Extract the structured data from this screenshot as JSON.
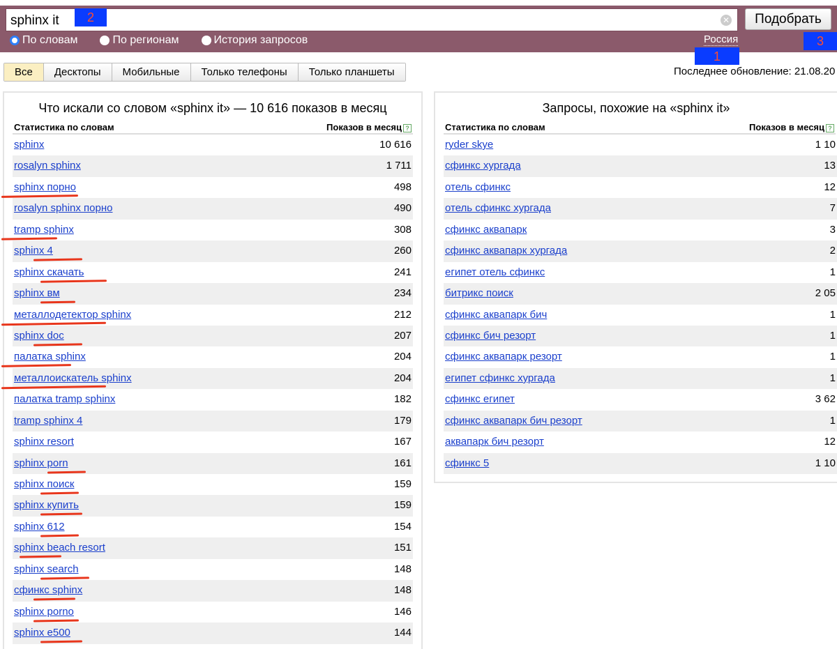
{
  "search": {
    "value": "sphinx it",
    "button": "Подобрать",
    "clear_icon": "clear-icon"
  },
  "modes": [
    {
      "label": "По словам",
      "selected": true
    },
    {
      "label": "По регионам",
      "selected": false
    },
    {
      "label": "История запросов",
      "selected": false
    }
  ],
  "region": "Россия",
  "markers": [
    "1",
    "2",
    "3"
  ],
  "device_tabs": [
    "Все",
    "Десктопы",
    "Мобильные",
    "Только телефоны",
    "Только планшеты"
  ],
  "active_tab": "Все",
  "last_update": "Последнее обновление: 21.08.20",
  "left": {
    "title": "Что искали со словом «sphinx it» — 10 616 показов в месяц",
    "col1": "Статистика по словам",
    "col2": "Показов в месяц",
    "rows": [
      [
        "sphinx",
        "10 616"
      ],
      [
        "rosalyn sphinx",
        "1 711"
      ],
      [
        "sphinx порно",
        "498"
      ],
      [
        "rosalyn sphinx порно",
        "490"
      ],
      [
        "tramp sphinx",
        "308"
      ],
      [
        "sphinx 4",
        "260"
      ],
      [
        "sphinx скачать",
        "241"
      ],
      [
        "sphinx вм",
        "234"
      ],
      [
        "металлодетектор sphinx",
        "212"
      ],
      [
        "sphinx doc",
        "207"
      ],
      [
        "палатка sphinx",
        "204"
      ],
      [
        "металлоискатель sphinx",
        "204"
      ],
      [
        "палатка tramp sphinx",
        "182"
      ],
      [
        "tramp sphinx 4",
        "179"
      ],
      [
        "sphinx resort",
        "167"
      ],
      [
        "sphinx porn",
        "161"
      ],
      [
        "sphinx поиск",
        "159"
      ],
      [
        "sphinx купить",
        "159"
      ],
      [
        "sphinx 612",
        "154"
      ],
      [
        "sphinx beach resort",
        "151"
      ],
      [
        "sphinx search",
        "148"
      ],
      [
        "сфинкс sphinx",
        "148"
      ],
      [
        "sphinx porno",
        "146"
      ],
      [
        "sphinx e500",
        "144"
      ]
    ]
  },
  "right": {
    "title": "Запросы, похожие на «sphinx it»",
    "col1": "Статистика по словам",
    "col2": "Показов в месяц",
    "rows": [
      [
        "ryder skye",
        "1 10"
      ],
      [
        "сфинкс хургада",
        "13"
      ],
      [
        "отель сфинкс",
        "12"
      ],
      [
        "отель сфинкс хургада",
        "7"
      ],
      [
        "сфинкс аквапарк",
        "3"
      ],
      [
        "сфинкс аквапарк хургада",
        "2"
      ],
      [
        "египет отель сфинкс",
        "1"
      ],
      [
        "битрикс поиск",
        "2 05"
      ],
      [
        "сфинкс аквапарк бич",
        "1"
      ],
      [
        "сфинкс бич резорт",
        "1"
      ],
      [
        "сфинкс аквапарк резорт",
        "1"
      ],
      [
        "египет сфинкс хургада",
        "1"
      ],
      [
        "сфинкс египет",
        "3 62"
      ],
      [
        "сфинкс аквапарк бич резорт",
        "1"
      ],
      [
        "аквапарк бич резорт",
        "12"
      ],
      [
        "сфинкс 5",
        "1 10"
      ]
    ]
  },
  "colors": {
    "topbar": "#8b5a6b",
    "link": "#1a3fcc",
    "annotation": "#e8361c",
    "marker": "#0a3cff"
  }
}
